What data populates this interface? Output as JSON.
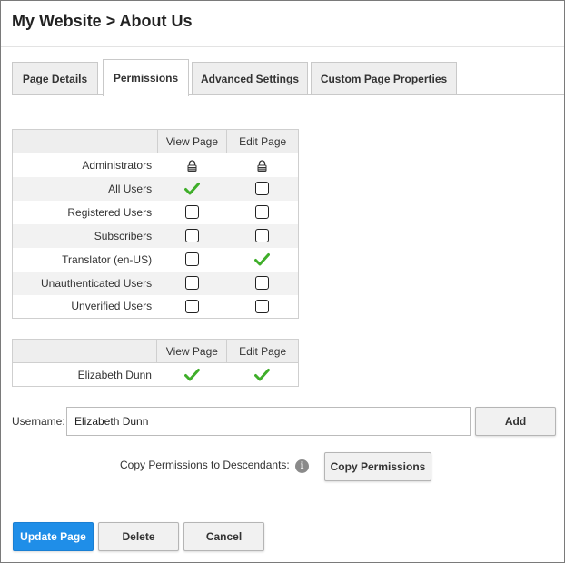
{
  "page": {
    "title": "My Website > About Us"
  },
  "tabs": [
    {
      "label": "Page Details",
      "active": false
    },
    {
      "label": "Permissions",
      "active": true
    },
    {
      "label": "Advanced Settings",
      "active": false
    },
    {
      "label": "Custom Page Properties",
      "active": false
    }
  ],
  "role_permissions": {
    "columns": [
      "View Page",
      "Edit Page"
    ],
    "rows": [
      {
        "name": "Administrators",
        "view": "locked",
        "edit": "locked"
      },
      {
        "name": "All Users",
        "view": "checked",
        "edit": "unchecked"
      },
      {
        "name": "Registered Users",
        "view": "unchecked",
        "edit": "unchecked"
      },
      {
        "name": "Subscribers",
        "view": "unchecked",
        "edit": "unchecked"
      },
      {
        "name": "Translator (en-US)",
        "view": "unchecked",
        "edit": "checked"
      },
      {
        "name": "Unauthenticated Users",
        "view": "unchecked",
        "edit": "unchecked"
      },
      {
        "name": "Unverified Users",
        "view": "unchecked",
        "edit": "unchecked"
      }
    ]
  },
  "user_permissions": {
    "columns": [
      "View Page",
      "Edit Page"
    ],
    "rows": [
      {
        "name": "Elizabeth Dunn",
        "view": "checked",
        "edit": "checked"
      }
    ]
  },
  "username": {
    "label": "Username:",
    "value": "Elizabeth Dunn"
  },
  "buttons": {
    "add": "Add",
    "copy_permissions": "Copy Permissions",
    "update_page": "Update Page",
    "delete": "Delete",
    "cancel": "Cancel"
  },
  "copy_descendants_label": "Copy Permissions to Descendants:",
  "colors": {
    "primary": "#1f8ee8",
    "check_green": "#3fae2a"
  }
}
